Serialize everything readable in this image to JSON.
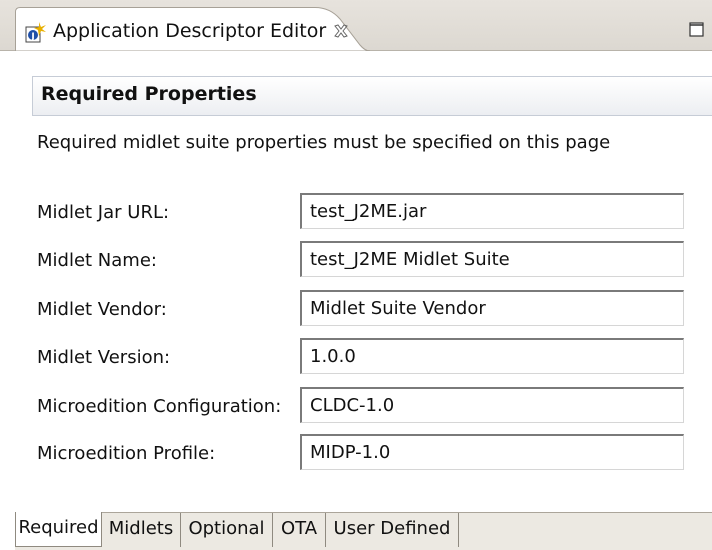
{
  "editor_tab": {
    "title": "Application Descriptor Editor",
    "icon": "java-descriptor-icon",
    "close_icon": "close-icon"
  },
  "window": {
    "maximize_icon": "maximize-icon"
  },
  "section": {
    "title": "Required Properties",
    "description": "Required midlet suite properties must be specified on this page"
  },
  "fields": [
    {
      "label": "Midlet Jar URL:",
      "value": "test_J2ME.jar"
    },
    {
      "label": "Midlet Name:",
      "value": "test_J2ME Midlet Suite"
    },
    {
      "label": "Midlet Vendor:",
      "value": "Midlet Suite Vendor"
    },
    {
      "label": "Midlet Version:",
      "value": "1.0.0"
    },
    {
      "label": "Microedition Configuration:",
      "value": "CLDC-1.0"
    },
    {
      "label": "Microedition Profile:",
      "value": "MIDP-1.0"
    }
  ],
  "page_tabs": [
    {
      "label": "Required",
      "active": true
    },
    {
      "label": "Midlets",
      "active": false
    },
    {
      "label": "Optional",
      "active": false
    },
    {
      "label": "OTA",
      "active": false
    },
    {
      "label": "User Defined",
      "active": false
    }
  ],
  "colors": {
    "tab_bar_bg": "#e7e3dd",
    "section_header_border": "#c6ccd6",
    "field_border_dark": "#7a7a7a"
  }
}
